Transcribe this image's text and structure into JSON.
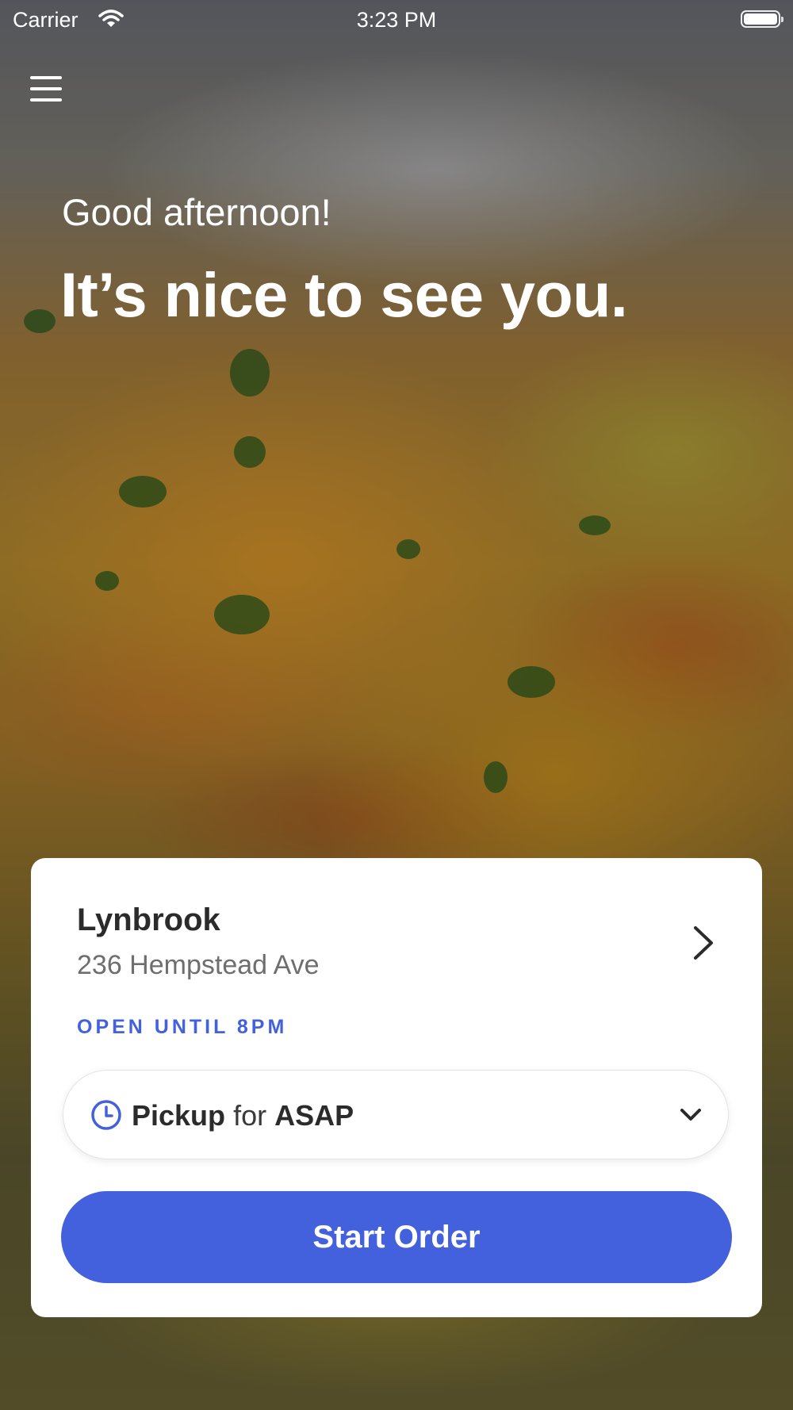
{
  "status_bar": {
    "carrier": "Carrier",
    "time": "3:23 PM"
  },
  "hero": {
    "greeting": "Good afternoon!",
    "headline": "It’s nice to see you."
  },
  "location_card": {
    "name": "Lynbrook",
    "address": "236 Hempstead Ave",
    "hours": "OPEN UNTIL 8PM",
    "order_type": {
      "mode": "Pickup",
      "connector": "for",
      "time": "ASAP"
    },
    "start_button": "Start Order"
  },
  "colors": {
    "accent": "#4360dd",
    "card_background": "#ffffff",
    "text_primary": "#2b2b2b",
    "text_secondary": "#6e6e6e"
  },
  "icons": {
    "menu": "hamburger-menu-icon",
    "wifi": "wifi-icon",
    "battery": "battery-icon",
    "location_arrow": "chevron-right-icon",
    "time": "clock-icon",
    "dropdown": "chevron-down-icon"
  }
}
